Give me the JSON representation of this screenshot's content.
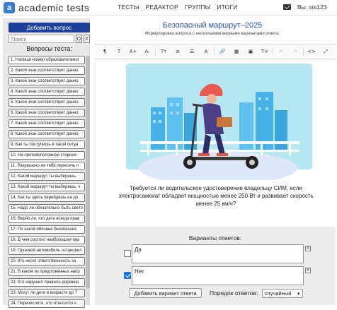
{
  "header": {
    "logo_letter": "a",
    "logo_text": "academic tests",
    "nav": [
      "ТЕСТЫ",
      "РЕДАКТОР",
      "ГРУППЫ",
      "ИТОГИ"
    ],
    "user": "Вы: sts123"
  },
  "sidebar": {
    "add_button": "Добавить вопрос",
    "search_placeholder": "Поиск",
    "search_go": "Q",
    "search_clear": "X",
    "list_title": "Вопросы теста:",
    "questions": [
      "1. Напиши номер образовательног",
      "2. Какой знак соответствует данно",
      "3. Какой знак соответствует данно",
      "4. Какой знак соответствует данно",
      "5. Какой знак соответствует данно",
      "6. Какой знак соответствует данно",
      "7. Какой знак соответствует данно",
      "8. Какой знак соответствует данно",
      "9. Как ты поступишь в такой ситуа",
      "10. На противоположной стороне",
      "11. Разрешено ли тебе пересечь п",
      "12. Какой маршрут ты выберешь,",
      "13. Какой маршрут ты выберешь, ч",
      "14. Как ты здесь перейдешь на до",
      "15. Надо ли обязательно быть свето",
      "16. Верно ли, что дети всегда прав",
      "17. По какой обочине безопаснее",
      "18. В чем состоит наибольшая опа",
      "19. Грузовой автомобиль остановил",
      "20. Кто несет ответственность за",
      "21. В каком из предложенных напр",
      "22. Кто нарушил правила дорожно",
      "23. Могут ли дети в возрасте до 7",
      "24. Перечислите, что относится к"
    ]
  },
  "survey": {
    "title": "Безопасный маршрут–2025",
    "subtitle": "Формулировка вопроса с несколькими верными вариантами ответа:",
    "question_text": "Требуется ли водительское удостоверение владельцу СИМ, если электросамокат обладает мощностью менее 250 Вт и развивает скорость менее 25 км/ч?"
  },
  "toolbar": {
    "icons": [
      "paragraph-format-icon",
      "font-size-icon",
      "increase-font-icon",
      "decrease-font-icon",
      "text-style-icon",
      "align-icon",
      "list-icon",
      "text-color-icon",
      "link-icon",
      "table-icon",
      "image-icon",
      "clear-format-icon",
      "undo-icon",
      "redo-icon",
      "code-view-icon",
      "fullscreen-icon"
    ],
    "labels": [
      "¶",
      "T",
      "A+",
      "A-",
      "Tт",
      "≡",
      "☰",
      "A",
      "🔗",
      "▦",
      "▣",
      "T×",
      "↶",
      "↷",
      "<>",
      "⤢"
    ]
  },
  "answers": {
    "title": "Варианты ответов:",
    "items": [
      {
        "text": "Да",
        "checked": false
      },
      {
        "text": "Нет",
        "checked": true
      }
    ],
    "remove_label": "X",
    "add_button": "Добавить вариант ответа",
    "order_label": "Порядок ответов:",
    "order_value": "случайный"
  }
}
